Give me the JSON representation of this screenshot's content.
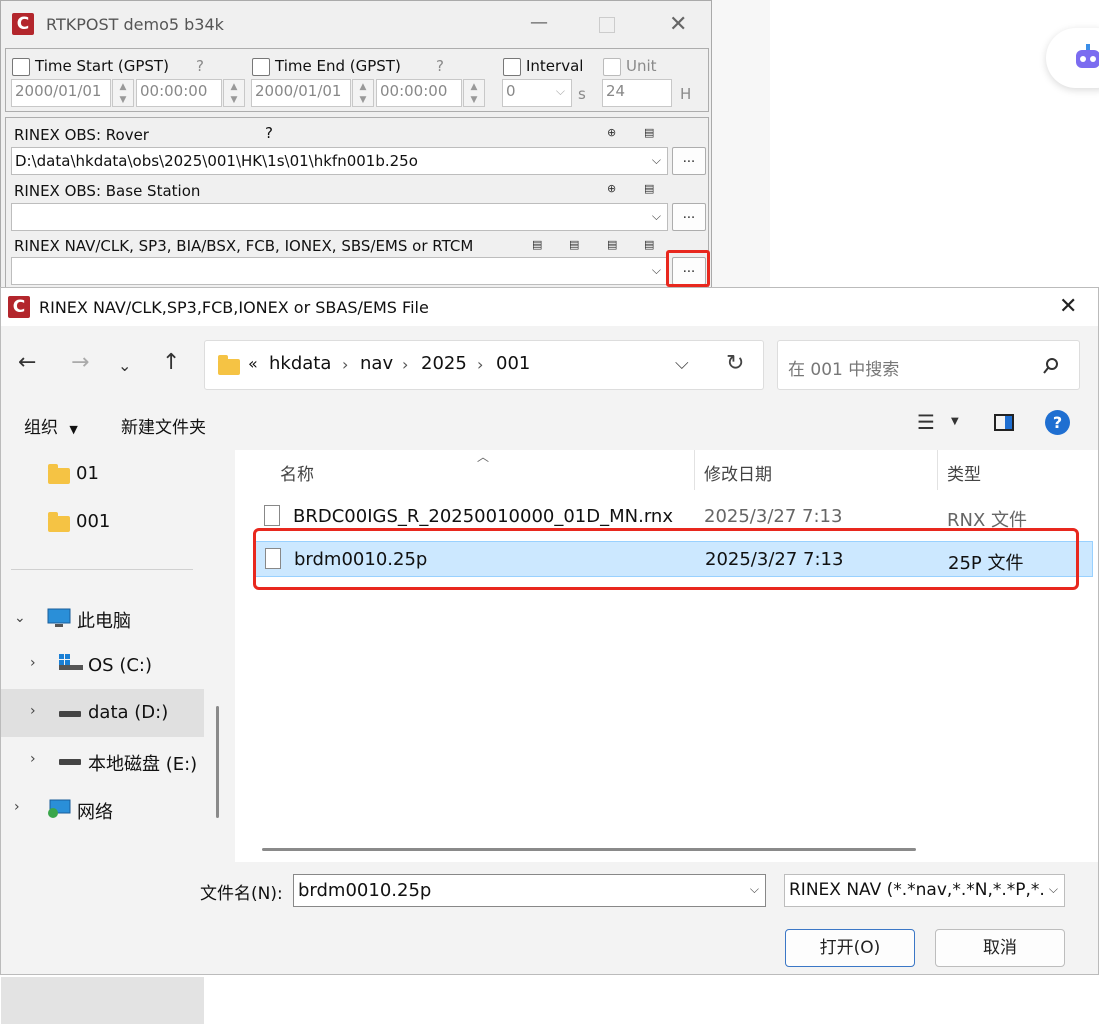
{
  "rtkpost": {
    "title": "RTKPOST demo5 b34k",
    "time_start_label": "Time Start (GPST)",
    "time_end_label": "Time End (GPST)",
    "question": "?",
    "interval_label": "Interval",
    "unit_label": "Unit",
    "start_date": "2000/01/01",
    "start_time": "00:00:00",
    "end_date": "2000/01/01",
    "end_time": "00:00:00",
    "interval_value": "0",
    "interval_unit": "s",
    "unit_value": "24",
    "unit_suffix": "H",
    "rover_label": "RINEX OBS: Rover",
    "rover_path": "D:\\data\\hkdata\\obs\\2025\\001\\HK\\1s\\01\\hkfn001b.25o",
    "base_label": "RINEX OBS: Base Station",
    "base_path": "",
    "nav_label": "RINEX NAV/CLK, SP3, BIA/BSX, FCB, IONEX, SBS/EMS  or RTCM",
    "nav_path": "",
    "browse": "...",
    "highlight_color": "#e8281e"
  },
  "dialog": {
    "title": "RINEX NAV/CLK,SP3,FCB,IONEX or SBAS/EMS File",
    "address": {
      "overflow": "«",
      "crumbs": [
        "hkdata",
        "nav",
        "2025",
        "001"
      ]
    },
    "search_placeholder": "在 001 中搜索",
    "toolbar": {
      "organize": "组织",
      "new_folder": "新建文件夹"
    },
    "tree": [
      {
        "label": "01"
      },
      {
        "label": "001"
      },
      {
        "label": "此电脑"
      },
      {
        "label": "OS (C:)"
      },
      {
        "label": "data (D:)"
      },
      {
        "label": "本地磁盘 (E:)"
      },
      {
        "label": "网络"
      }
    ],
    "columns": {
      "name": "名称",
      "date": "修改日期",
      "type": "类型"
    },
    "files": [
      {
        "name": "BRDC00IGS_R_20250010000_01D_MN.rnx",
        "date": "2025/3/27 7:13",
        "type": "RNX 文件"
      },
      {
        "name": "brdm0010.25p",
        "date": "2025/3/27 7:13",
        "type": "25P 文件"
      }
    ],
    "filename_label": "文件名(N):",
    "filename_value": "brdm0010.25p",
    "filter_value": "RINEX NAV (*.*nav,*.*N,*.*P,*.",
    "open_button": "打开(O)",
    "cancel_button": "取消",
    "selection_color": "#cce8ff"
  }
}
